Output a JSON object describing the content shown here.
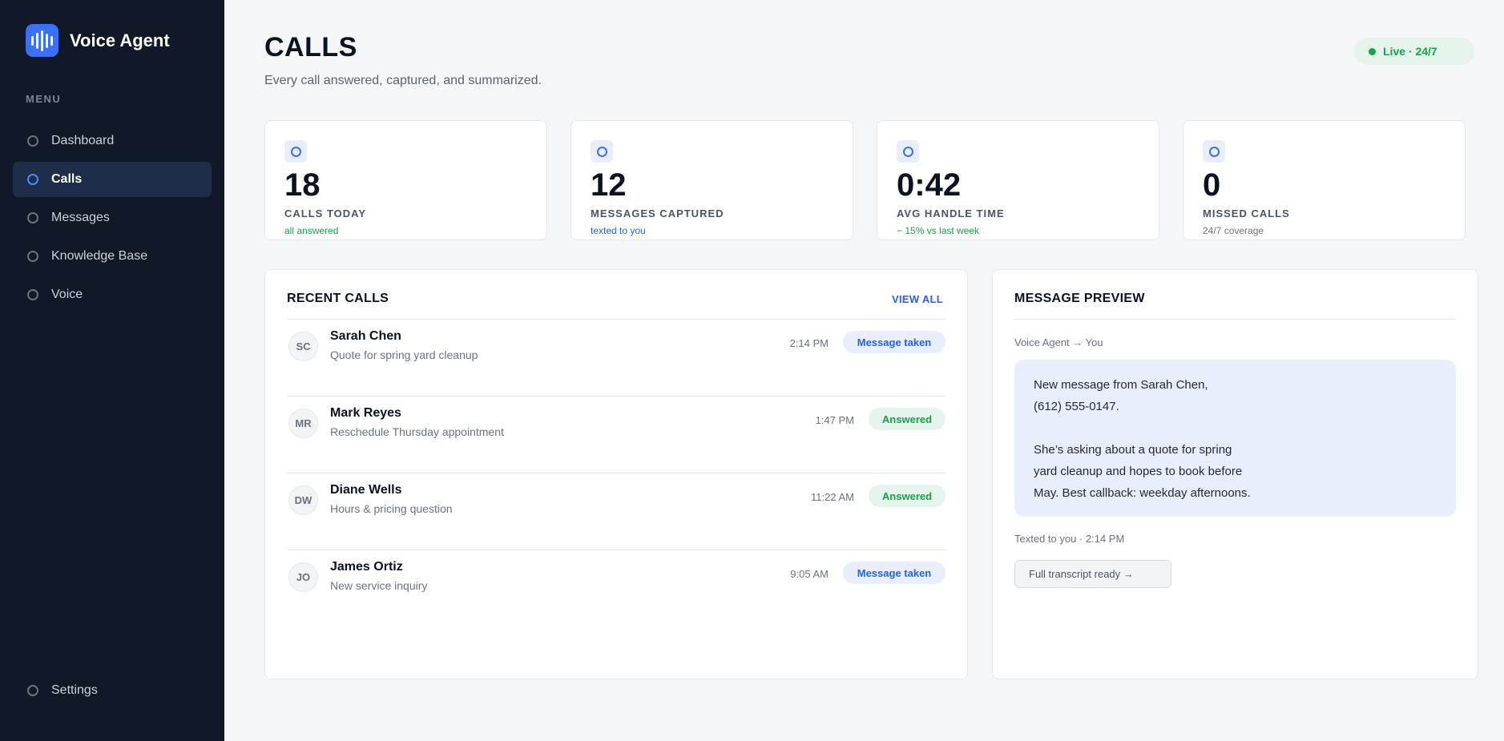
{
  "app": {
    "name": "Voice Agent"
  },
  "sidebar": {
    "menu_label": "MENU",
    "items": [
      {
        "label": "Dashboard",
        "icon": "circle-icon",
        "active": false
      },
      {
        "label": "Calls",
        "icon": "circle-icon",
        "active": true
      },
      {
        "label": "Messages",
        "icon": "circle-icon",
        "active": false
      },
      {
        "label": "Knowledge Base",
        "icon": "circle-icon",
        "active": false
      },
      {
        "label": "Voice",
        "icon": "circle-icon",
        "active": false
      }
    ],
    "settings_label": "Settings"
  },
  "header": {
    "title": "CALLS",
    "subtitle": "Every call answered, captured, and summarized.",
    "live_badge": "Live · 24/7"
  },
  "stats": [
    {
      "value": "18",
      "label": "CALLS TODAY",
      "note": "all answered",
      "note_color": "#16a34a"
    },
    {
      "value": "12",
      "label": "MESSAGES CAPTURED",
      "note": "texted to you",
      "note_color": "#2563eb"
    },
    {
      "value": "0:42",
      "label": "AVG HANDLE TIME",
      "note": "− 15% vs last week",
      "note_color": "#16a34a"
    },
    {
      "value": "0",
      "label": "MISSED CALLS",
      "note": "24/7 coverage",
      "note_color": "#6b7280"
    }
  ],
  "recent_calls": {
    "title": "RECENT CALLS",
    "view_all": "VIEW ALL",
    "rows": [
      {
        "initials": "SC",
        "name": "Sarah Chen",
        "summary": "Quote for spring yard cleanup",
        "time": "2:14 PM",
        "status": "Message taken"
      },
      {
        "initials": "MR",
        "name": "Mark Reyes",
        "summary": "Reschedule Thursday appointment",
        "time": "1:47 PM",
        "status": "Answered"
      },
      {
        "initials": "DW",
        "name": "Diane Wells",
        "summary": "Hours & pricing question",
        "time": "11:22 AM",
        "status": "Answered"
      },
      {
        "initials": "JO",
        "name": "James Ortiz",
        "summary": "New service inquiry",
        "time": "9:05 AM",
        "status": "Message taken"
      }
    ]
  },
  "message_preview": {
    "title": "MESSAGE PREVIEW",
    "from": "Voice Agent → You",
    "lines": [
      "New message from Sarah Chen,",
      "(612) 555-0147.",
      "",
      "She’s asking about a quote for spring",
      "yard cleanup and hopes to book before",
      "May. Best callback: weekday afternoons."
    ],
    "sent": "Texted to you · 2:14 PM",
    "transcript_button": "Full transcript ready →"
  },
  "colors": {
    "sidebar_bg": "#111827",
    "accent": "#3b6ff6",
    "success": "#16a34a"
  }
}
